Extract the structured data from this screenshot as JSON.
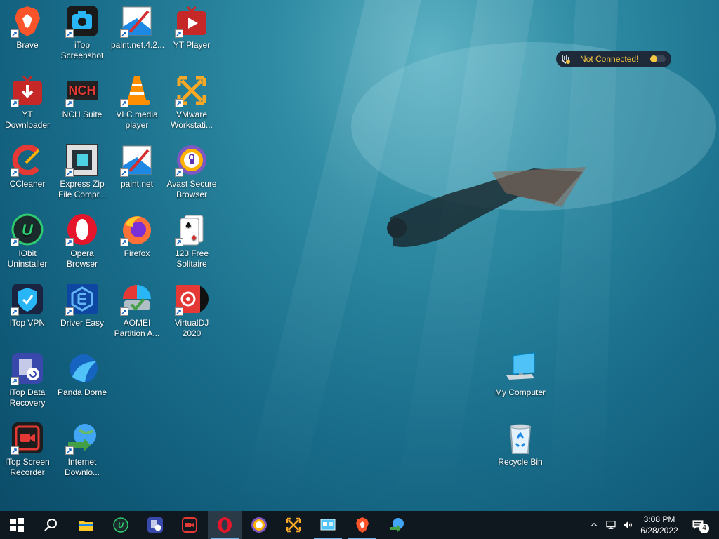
{
  "desktop_icons": [
    {
      "label": "Brave"
    },
    {
      "label": "iTop Screenshot"
    },
    {
      "label": "paint.net.4.2..."
    },
    {
      "label": "YT Player"
    },
    {
      "label": "YT Downloader"
    },
    {
      "label": "NCH Suite"
    },
    {
      "label": "VLC media player"
    },
    {
      "label": "VMware Workstati..."
    },
    {
      "label": "CCleaner"
    },
    {
      "label": "Express Zip File Compr..."
    },
    {
      "label": "paint.net"
    },
    {
      "label": "Avast Secure Browser"
    },
    {
      "label": "IObit Uninstaller"
    },
    {
      "label": "Opera Browser"
    },
    {
      "label": "Firefox"
    },
    {
      "label": "123 Free Solitaire"
    },
    {
      "label": "iTop VPN"
    },
    {
      "label": "Driver Easy"
    },
    {
      "label": "AOMEI Partition A..."
    },
    {
      "label": "VirtualDJ 2020"
    },
    {
      "label": "iTop Data Recovery"
    },
    {
      "label": "Panda Dome"
    },
    {
      "label": "iTop Screen Recorder"
    },
    {
      "label": "Internet Downlo..."
    },
    {
      "label": "My Computer"
    },
    {
      "label": "Recycle Bin"
    }
  ],
  "vpn_widget": {
    "status": "Not Connected!"
  },
  "taskbar": {
    "time": "3:08 PM",
    "date": "6/28/2022",
    "notification_count": "4"
  },
  "colors": {
    "accent": "#6fb3e8",
    "taskbar": "#10181f"
  }
}
